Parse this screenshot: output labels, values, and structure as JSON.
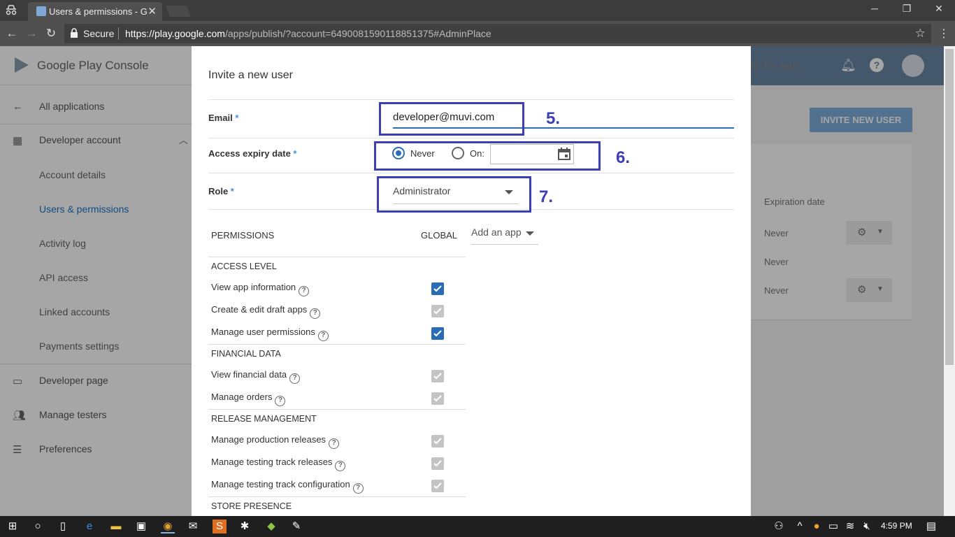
{
  "browser": {
    "tab_title": "Users & permissions - Go",
    "secure_label": "Secure",
    "url_host": "https://play.google.com",
    "url_path": "/apps/publish/?account=6490081590118851375#AdminPlace"
  },
  "app": {
    "logo_text": "Google Play Console",
    "search_placeholder": "rch for apps"
  },
  "sidebar": {
    "items": [
      {
        "label": "All applications",
        "icon": "arrow-left-icon"
      },
      {
        "label": "Developer account",
        "icon": "building-icon"
      },
      {
        "label": "Account details"
      },
      {
        "label": "Users & permissions"
      },
      {
        "label": "Activity log"
      },
      {
        "label": "API access"
      },
      {
        "label": "Linked accounts"
      },
      {
        "label": "Payments settings"
      },
      {
        "label": "Developer page",
        "icon": "web-page-icon"
      },
      {
        "label": "Manage testers",
        "icon": "people-icon"
      },
      {
        "label": "Preferences",
        "icon": "tune-icon"
      }
    ]
  },
  "right_panel": {
    "invite_button": "INVITE NEW USER",
    "expiration_header": "Expiration date",
    "rows": [
      "Never",
      "Never",
      "Never"
    ]
  },
  "dialog": {
    "title": "Invite a new user",
    "email_label": "Email",
    "email_value": "developer@muvi.com",
    "expiry_label": "Access expiry date",
    "never_label": "Never",
    "on_label": "On:",
    "role_label": "Role",
    "role_value": "Administrator",
    "required_mark": "*",
    "permissions_header": "PERMISSIONS",
    "global_header": "GLOBAL",
    "add_app_label": "Add an app",
    "sections": [
      {
        "label": "ACCESS LEVEL",
        "items": [
          {
            "label": "View app information",
            "state": "blue"
          },
          {
            "label": "Create & edit draft apps",
            "state": "gray"
          },
          {
            "label": "Manage user permissions",
            "state": "blue"
          }
        ]
      },
      {
        "label": "FINANCIAL DATA",
        "items": [
          {
            "label": "View financial data",
            "state": "gray"
          },
          {
            "label": "Manage orders",
            "state": "gray"
          }
        ]
      },
      {
        "label": "RELEASE MANAGEMENT",
        "items": [
          {
            "label": "Manage production releases",
            "state": "gray"
          },
          {
            "label": "Manage testing track releases",
            "state": "gray"
          },
          {
            "label": "Manage testing track configuration",
            "state": "gray"
          }
        ]
      },
      {
        "label": "STORE PRESENCE",
        "items": []
      }
    ]
  },
  "annotations": [
    "5.",
    "6.",
    "7."
  ],
  "taskbar": {
    "clock": "4:59 PM"
  },
  "colors": {
    "accent": "#2a6db4",
    "annotation": "#3b3fb3",
    "header_blue": "#6b86a4"
  }
}
